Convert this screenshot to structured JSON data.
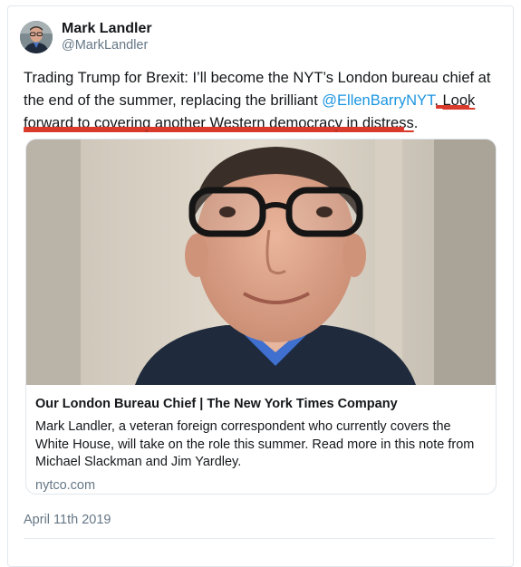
{
  "author": {
    "display_name": "Mark Landler",
    "handle": "@MarkLandler"
  },
  "tweet": {
    "text_part1": "Trading Trump for Brexit: I’ll become the NYT’s London bureau chief at the end of the summer, replacing the brilliant ",
    "mention": "@EllenBarryNYT",
    "text_part2": ". ",
    "highlighted_text": "Look forward to covering another Western democracy in distress",
    "text_end": ".",
    "date": "April 11th 2019"
  },
  "link_card": {
    "title": "Our London Bureau Chief | The New York Times Company",
    "description": "Mark Landler, a veteran foreign correspondent who currently covers the White House, will take on the role this summer. Read more in this note from Michael Slackman and Jim Yardley.",
    "domain": "nytco.com"
  },
  "colors": {
    "text": "#14171a",
    "secondary": "#657786",
    "mention": "#1b95e0",
    "annotation_red": "#d93a2b",
    "border": "#e1e8ed"
  }
}
